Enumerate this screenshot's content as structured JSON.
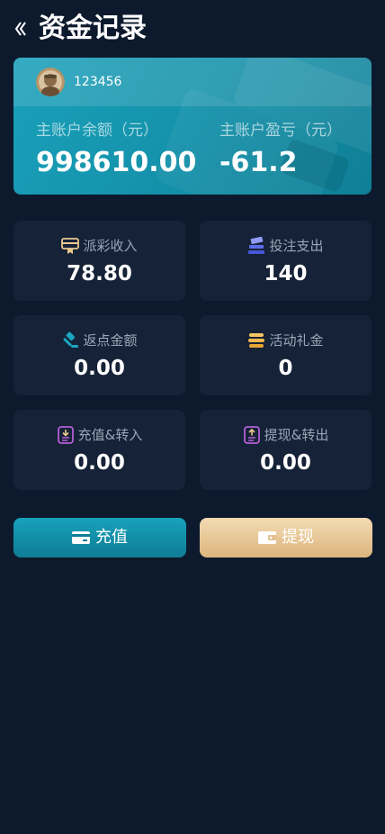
{
  "header": {
    "title": "资金记录"
  },
  "account": {
    "username": "123456",
    "balance_label": "主账户余额（元）",
    "balance_value": "998610.00",
    "profit_label": "主账户盈亏（元）",
    "profit_value": "-61.2"
  },
  "stats": [
    {
      "label": "派彩收入",
      "value": "78.80",
      "icon": "payout-icon",
      "color": "#e9c98e"
    },
    {
      "label": "投注支出",
      "value": "140",
      "icon": "bet-icon",
      "color": "#5b6ee8"
    },
    {
      "label": "返点金额",
      "value": "0.00",
      "icon": "rebate-icon",
      "color": "#1aa6c2"
    },
    {
      "label": "活动礼金",
      "value": "0",
      "icon": "coins-icon",
      "color": "#f2b84b"
    },
    {
      "label": "充值&转入",
      "value": "0.00",
      "icon": "deposit-icon",
      "color": "#b35fd6"
    },
    {
      "label": "提现&转出",
      "value": "0.00",
      "icon": "withdraw-icon",
      "color": "#b35fd6"
    }
  ],
  "actions": {
    "deposit_label": "充值",
    "withdraw_label": "提现"
  }
}
